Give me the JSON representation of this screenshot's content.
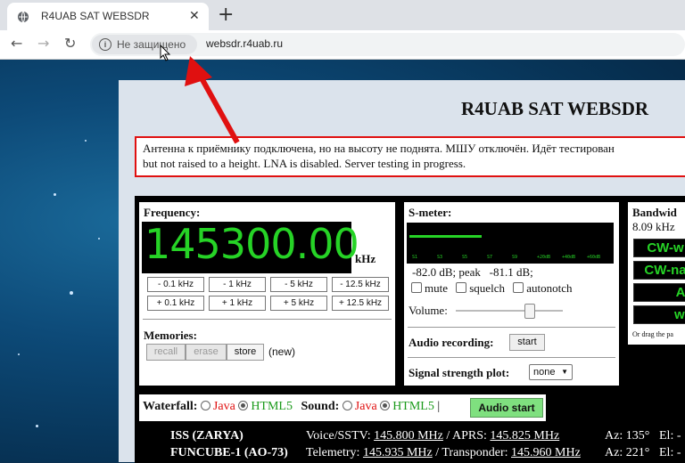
{
  "browser": {
    "tab_title": "R4UAB SAT WEBSDR",
    "tab_close": "✕",
    "new_tab": "+",
    "back": "←",
    "forward": "→",
    "reload": "↻",
    "security_label": "Не защищено",
    "url": "websdr.r4uab.ru"
  },
  "page": {
    "title": "R4UAB SAT WEBSDR",
    "notice_line1": "Антенна к приёмнику подключена, но на высоту не поднята. МШУ отключён. Идёт тестирован",
    "notice_line2": "but not raised to a height. LNA is disabled. Server testing in progress."
  },
  "frequency": {
    "label": "Frequency:",
    "value": "145300.00",
    "unit": "kHz",
    "step_buttons": [
      "- 0.1 kHz",
      "- 1 kHz",
      "- 5 kHz",
      "- 12.5 kHz",
      "+ 0.1 kHz",
      "+ 1 kHz",
      "+ 5 kHz",
      "+ 12.5 kHz"
    ]
  },
  "memories": {
    "label": "Memories:",
    "recall": "recall",
    "erase": "erase",
    "store": "store",
    "status": "(new)"
  },
  "smeter": {
    "label": "S-meter:",
    "ticks": [
      "S1",
      "S3",
      "S5",
      "S7",
      "S9",
      "+20dB",
      "+40dB",
      "+60dB"
    ],
    "level_fraction": 0.36,
    "readout": "-82.0 dB; peak   -81.1 dB;",
    "mute": "mute",
    "squelch": "squelch",
    "autonotch": "autonotch",
    "volume_label": "Volume:",
    "volume_fraction": 0.68
  },
  "recording": {
    "label": "Audio recording:",
    "start": "start"
  },
  "plot": {
    "label": "Signal strength plot:",
    "selected": "none"
  },
  "bandwidth": {
    "label": "Bandwid",
    "value": "8.09 kHz",
    "buttons": [
      "CW-w",
      "CW-na",
      "AM",
      "wid"
    ],
    "hint": "Or drag the pa"
  },
  "waterfall": {
    "label": "Waterfall:",
    "java": "Java",
    "html5": "HTML5",
    "sound_label": "Sound:",
    "sound_java": "Java",
    "sound_html5": "HTML5",
    "separator": "|",
    "audio_start": "Audio start"
  },
  "satellites": [
    {
      "name": "ISS (ZARYA)",
      "prefix1": "Voice/SSTV: ",
      "f1": "145.800 MHz",
      "prefix2": " / APRS: ",
      "f2": "145.825 MHz",
      "az": "Az: 135°",
      "el": "El: -"
    },
    {
      "name": "FUNCUBE-1 (AO-73)",
      "prefix1": "Telemetry: ",
      "f1": "145.935 MHz",
      "prefix2": " / Transponder: ",
      "f2": "145.960 MHz",
      "az": "Az: 221°",
      "el": "El: -"
    }
  ],
  "colors": {
    "accent_green": "#26d326",
    "notice_border": "#e01010",
    "java_red": "#e01010",
    "html5_green": "#1a9a1a"
  }
}
